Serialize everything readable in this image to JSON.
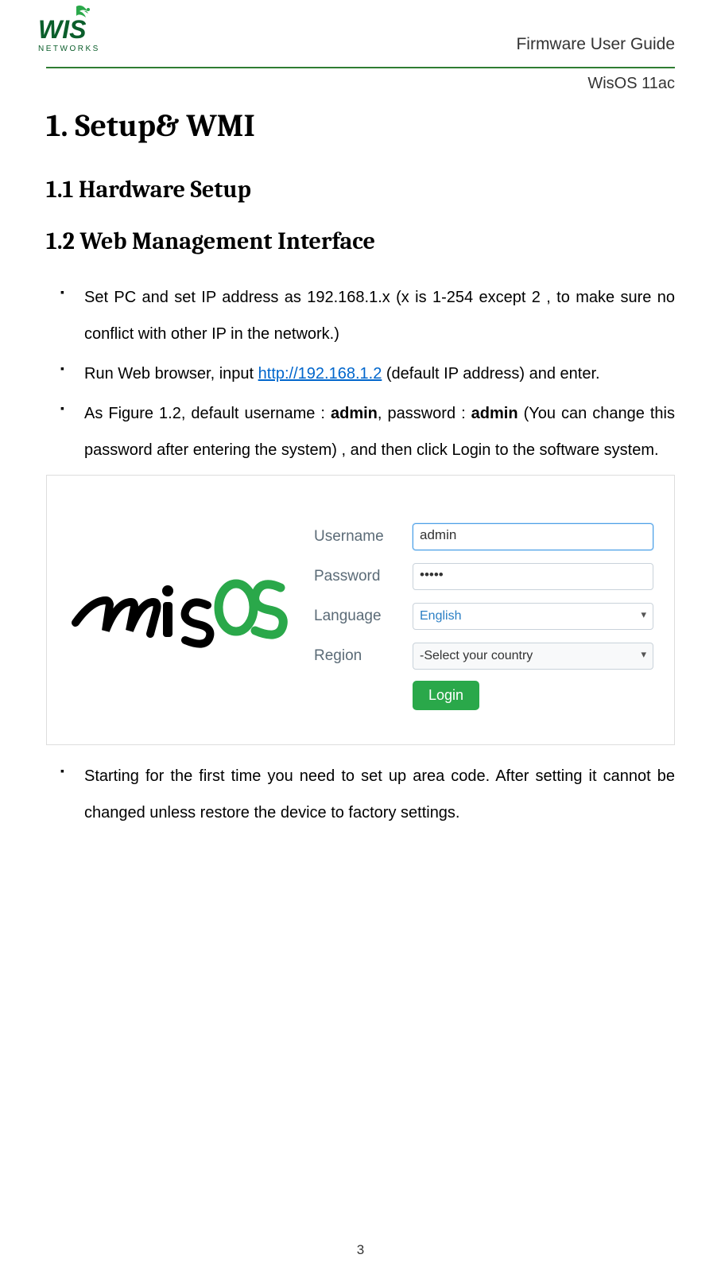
{
  "header": {
    "title": "Firmware User Guide",
    "subtitle": "WisOS 11ac"
  },
  "h1": "1. Setup& WMI",
  "h2a": "1.1 Hardware Setup",
  "h2b": "1.2 Web Management Interface",
  "bullets": {
    "b1": "Set PC and set IP address as 192.168.1.x  (x is 1-254 except 2 ,  to make sure no conflict with other IP in the network.)",
    "b2_pre": "Run Web browser, input   ",
    "b2_link": "http://192.168.1.2",
    "b2_post": " (default IP address) and enter.",
    "b3_a": "As Figure 1.2, default username : ",
    "b3_admin1": "admin",
    "b3_b": ", password : ",
    "b3_admin2": "admin",
    "b3_c": " (You can change this password after entering the system) , and then click Login to the software system.",
    "b4": "Starting for the first time you need to set up area code. After setting it cannot be changed unless restore the device to factory settings."
  },
  "figure": {
    "logo_text": "WIS OS",
    "username_label": "Username",
    "username_value": "admin",
    "password_label": "Password",
    "password_value": "•••••",
    "language_label": "Language",
    "language_value": "English",
    "region_label": "Region",
    "region_value": "-Select your country",
    "login_label": "Login"
  },
  "page_number": "3"
}
